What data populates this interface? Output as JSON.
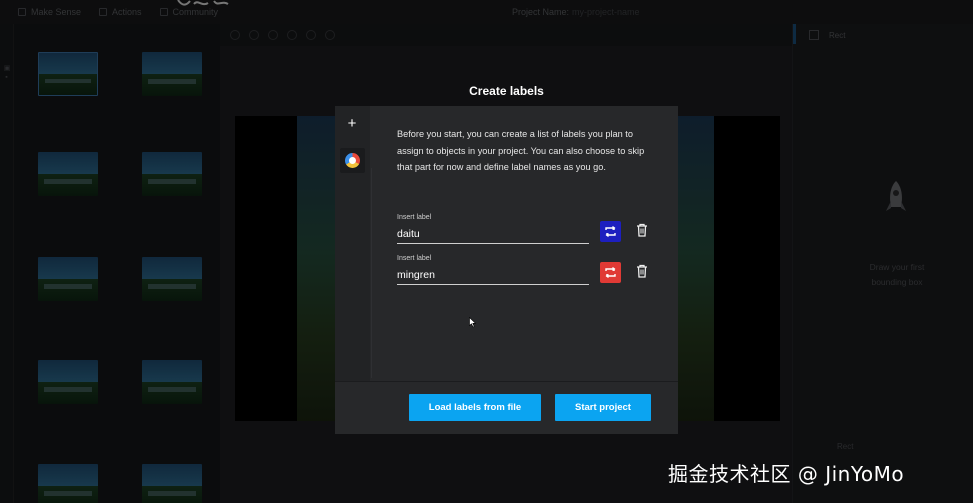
{
  "topbar": {
    "menu": [
      {
        "label": "Make Sense",
        "icon": "square-icon"
      },
      {
        "label": "Actions",
        "icon": "actions-icon"
      },
      {
        "label": "Community",
        "icon": "community-icon"
      }
    ],
    "project_name_label": "Project Name:",
    "project_name_value": "my-project-name"
  },
  "right_panel": {
    "header": "Rect",
    "empty_text": "Draw your first bounding box",
    "footer": "Rect"
  },
  "modal": {
    "title": "Create labels",
    "add_icon": "plus-icon",
    "description": "Before you start, you can create a list of labels you plan to assign to objects in your project. You can also choose to skip that part for now and define label names as you go.",
    "labels": [
      {
        "caption": "Insert label",
        "value": "daitu",
        "color": "#1d1fbf"
      },
      {
        "caption": "Insert label",
        "value": "mingren",
        "color": "#e03a35"
      }
    ],
    "buttons": {
      "load": "Load labels from file",
      "start": "Start project"
    }
  },
  "watermark": "掘金技术社区 @ JinYoMo",
  "colors": {
    "accent": "#0ba4f1",
    "modal_bg": "#27282a"
  }
}
